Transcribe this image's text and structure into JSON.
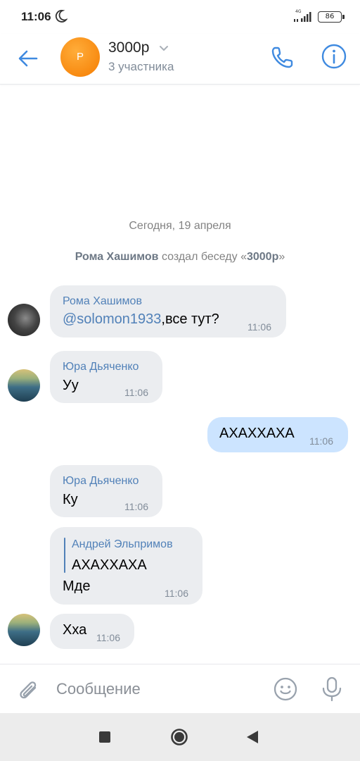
{
  "status_bar": {
    "time": "11:06",
    "network": "4G",
    "battery": "86",
    "battery_level": 0.86
  },
  "header": {
    "avatar_letter": "Р",
    "title": "3000р",
    "subtitle": "3 участника",
    "icons": [
      "back-arrow-icon",
      "chevron-down-icon",
      "phone-icon",
      "info-icon"
    ]
  },
  "chat": {
    "date": "Сегодня, 19 апреля",
    "service": {
      "author": "Рома Хашимов",
      "action": " создал беседу «",
      "chat_name": "3000р",
      "close_quote": "»"
    },
    "messages": [
      {
        "sender": "Рома Хашимов",
        "mention": "@solomon1933",
        "text": ",все тут?",
        "time": "11:06"
      },
      {
        "sender": "Юра Дьяченко",
        "text": "Уу",
        "time": "11:06"
      },
      {
        "text": "АХАХХАХА",
        "time": "11:06",
        "outgoing": true
      },
      {
        "sender": "Юра Дьяченко",
        "text": "Ку",
        "time": "11:06"
      },
      {
        "quote_author": "Андрей Эльпримов",
        "quote_text": "АХАХХАХА",
        "text": "Мде",
        "time": "11:06"
      },
      {
        "text": "Хха",
        "time": "11:06"
      }
    ]
  },
  "input": {
    "placeholder": "Сообщение"
  },
  "colors": {
    "accent": "#5181b8",
    "incoming_bubble": "#ebedf0",
    "outgoing_bubble": "#cce4ff",
    "avatar_orange": "#f57c00"
  }
}
